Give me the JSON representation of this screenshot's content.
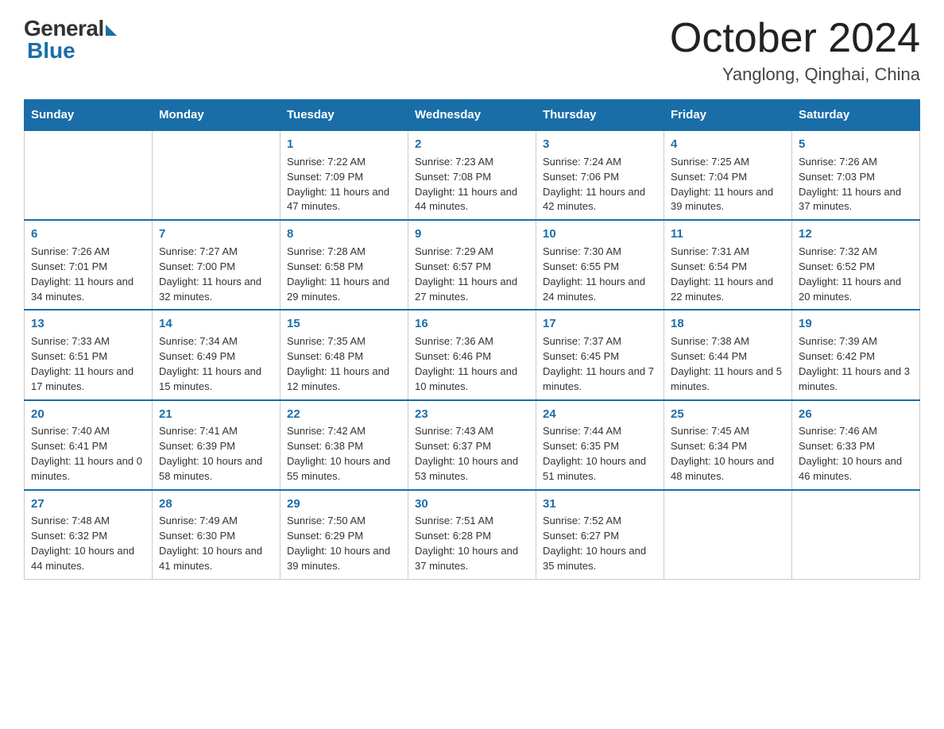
{
  "header": {
    "logo_general": "General",
    "logo_blue": "Blue",
    "month_title": "October 2024",
    "location": "Yanglong, Qinghai, China"
  },
  "days_of_week": [
    "Sunday",
    "Monday",
    "Tuesday",
    "Wednesday",
    "Thursday",
    "Friday",
    "Saturday"
  ],
  "weeks": [
    [
      {
        "day": "",
        "info": ""
      },
      {
        "day": "",
        "info": ""
      },
      {
        "day": "1",
        "info": "Sunrise: 7:22 AM\nSunset: 7:09 PM\nDaylight: 11 hours and 47 minutes."
      },
      {
        "day": "2",
        "info": "Sunrise: 7:23 AM\nSunset: 7:08 PM\nDaylight: 11 hours and 44 minutes."
      },
      {
        "day": "3",
        "info": "Sunrise: 7:24 AM\nSunset: 7:06 PM\nDaylight: 11 hours and 42 minutes."
      },
      {
        "day": "4",
        "info": "Sunrise: 7:25 AM\nSunset: 7:04 PM\nDaylight: 11 hours and 39 minutes."
      },
      {
        "day": "5",
        "info": "Sunrise: 7:26 AM\nSunset: 7:03 PM\nDaylight: 11 hours and 37 minutes."
      }
    ],
    [
      {
        "day": "6",
        "info": "Sunrise: 7:26 AM\nSunset: 7:01 PM\nDaylight: 11 hours and 34 minutes."
      },
      {
        "day": "7",
        "info": "Sunrise: 7:27 AM\nSunset: 7:00 PM\nDaylight: 11 hours and 32 minutes."
      },
      {
        "day": "8",
        "info": "Sunrise: 7:28 AM\nSunset: 6:58 PM\nDaylight: 11 hours and 29 minutes."
      },
      {
        "day": "9",
        "info": "Sunrise: 7:29 AM\nSunset: 6:57 PM\nDaylight: 11 hours and 27 minutes."
      },
      {
        "day": "10",
        "info": "Sunrise: 7:30 AM\nSunset: 6:55 PM\nDaylight: 11 hours and 24 minutes."
      },
      {
        "day": "11",
        "info": "Sunrise: 7:31 AM\nSunset: 6:54 PM\nDaylight: 11 hours and 22 minutes."
      },
      {
        "day": "12",
        "info": "Sunrise: 7:32 AM\nSunset: 6:52 PM\nDaylight: 11 hours and 20 minutes."
      }
    ],
    [
      {
        "day": "13",
        "info": "Sunrise: 7:33 AM\nSunset: 6:51 PM\nDaylight: 11 hours and 17 minutes."
      },
      {
        "day": "14",
        "info": "Sunrise: 7:34 AM\nSunset: 6:49 PM\nDaylight: 11 hours and 15 minutes."
      },
      {
        "day": "15",
        "info": "Sunrise: 7:35 AM\nSunset: 6:48 PM\nDaylight: 11 hours and 12 minutes."
      },
      {
        "day": "16",
        "info": "Sunrise: 7:36 AM\nSunset: 6:46 PM\nDaylight: 11 hours and 10 minutes."
      },
      {
        "day": "17",
        "info": "Sunrise: 7:37 AM\nSunset: 6:45 PM\nDaylight: 11 hours and 7 minutes."
      },
      {
        "day": "18",
        "info": "Sunrise: 7:38 AM\nSunset: 6:44 PM\nDaylight: 11 hours and 5 minutes."
      },
      {
        "day": "19",
        "info": "Sunrise: 7:39 AM\nSunset: 6:42 PM\nDaylight: 11 hours and 3 minutes."
      }
    ],
    [
      {
        "day": "20",
        "info": "Sunrise: 7:40 AM\nSunset: 6:41 PM\nDaylight: 11 hours and 0 minutes."
      },
      {
        "day": "21",
        "info": "Sunrise: 7:41 AM\nSunset: 6:39 PM\nDaylight: 10 hours and 58 minutes."
      },
      {
        "day": "22",
        "info": "Sunrise: 7:42 AM\nSunset: 6:38 PM\nDaylight: 10 hours and 55 minutes."
      },
      {
        "day": "23",
        "info": "Sunrise: 7:43 AM\nSunset: 6:37 PM\nDaylight: 10 hours and 53 minutes."
      },
      {
        "day": "24",
        "info": "Sunrise: 7:44 AM\nSunset: 6:35 PM\nDaylight: 10 hours and 51 minutes."
      },
      {
        "day": "25",
        "info": "Sunrise: 7:45 AM\nSunset: 6:34 PM\nDaylight: 10 hours and 48 minutes."
      },
      {
        "day": "26",
        "info": "Sunrise: 7:46 AM\nSunset: 6:33 PM\nDaylight: 10 hours and 46 minutes."
      }
    ],
    [
      {
        "day": "27",
        "info": "Sunrise: 7:48 AM\nSunset: 6:32 PM\nDaylight: 10 hours and 44 minutes."
      },
      {
        "day": "28",
        "info": "Sunrise: 7:49 AM\nSunset: 6:30 PM\nDaylight: 10 hours and 41 minutes."
      },
      {
        "day": "29",
        "info": "Sunrise: 7:50 AM\nSunset: 6:29 PM\nDaylight: 10 hours and 39 minutes."
      },
      {
        "day": "30",
        "info": "Sunrise: 7:51 AM\nSunset: 6:28 PM\nDaylight: 10 hours and 37 minutes."
      },
      {
        "day": "31",
        "info": "Sunrise: 7:52 AM\nSunset: 6:27 PM\nDaylight: 10 hours and 35 minutes."
      },
      {
        "day": "",
        "info": ""
      },
      {
        "day": "",
        "info": ""
      }
    ]
  ]
}
